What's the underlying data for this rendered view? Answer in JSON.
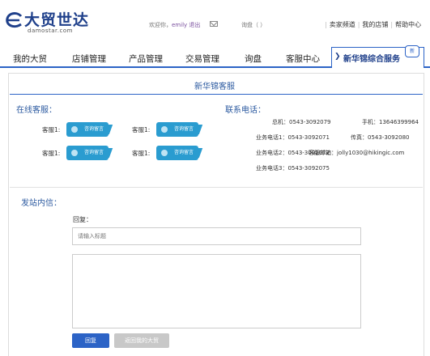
{
  "brand": {
    "name_cn": "大贸世达",
    "name_en": "damostar.com"
  },
  "header": {
    "welcome_prefix": "欢迎你，",
    "username": "emily",
    "logout": "退出",
    "inquiry": "询盘（ ）",
    "links": [
      "卖家频道",
      "我的店铺",
      "帮助中心"
    ]
  },
  "nav": {
    "items": [
      "我的大贸",
      "店铺管理",
      "产品管理",
      "交易管理",
      "询盘",
      "客服中心"
    ],
    "active": "新华锦综合服务",
    "badge": "新"
  },
  "page": {
    "title": "新华锦客服",
    "online_heading": "在线客服：",
    "phone_heading": "联系电话：",
    "cs_label": "客服1:",
    "cs_button": "咨询留言",
    "phones_left": [
      "总机：0543-3092079",
      "业务电话1：0543-3092071",
      "业务电话2：0543-3092072",
      "业务电话3：0543-3092075"
    ],
    "phones_right": [
      "手机：13646399964",
      "传真：0543-3092080",
      "客服邮箱：jolly1030@hikingic.com"
    ]
  },
  "message": {
    "heading": "发站内信：",
    "reply_label": "回复：",
    "title_placeholder": "请输入标题",
    "body_value": "",
    "reply_button": "回复",
    "back_button": "返回我的大贸"
  }
}
